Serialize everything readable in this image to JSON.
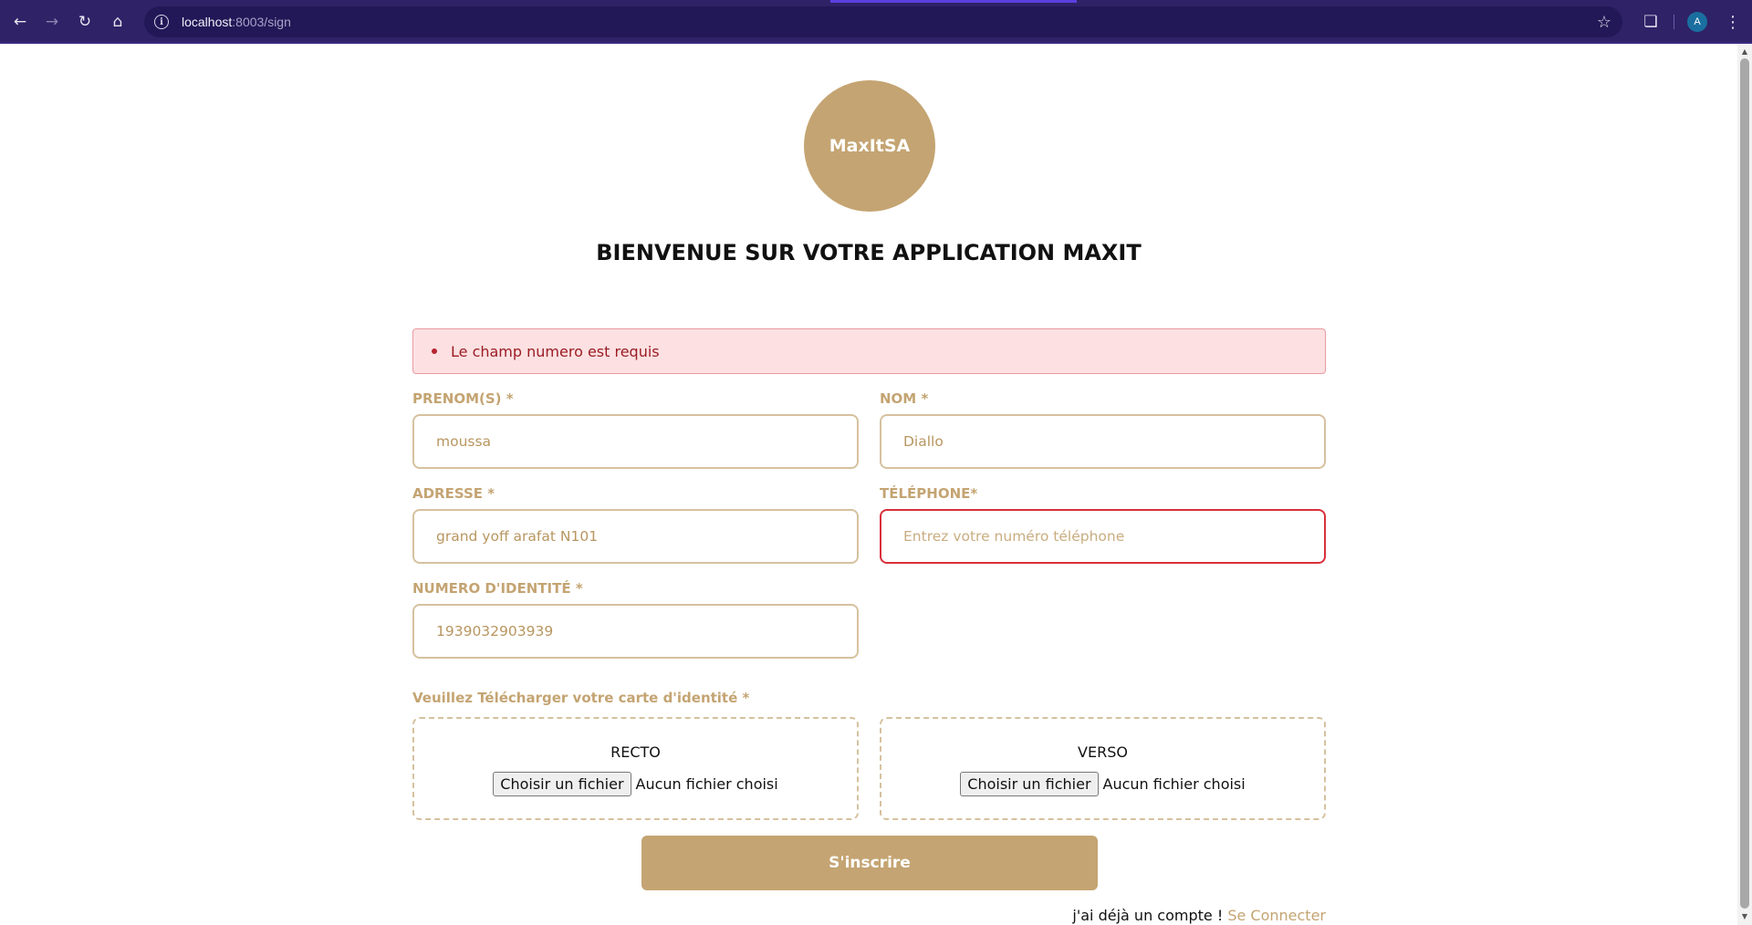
{
  "browser": {
    "url_host": "localhost",
    "url_rest": ":8003/sign",
    "avatar_letter": "A"
  },
  "logo": {
    "text": "MaxItSA"
  },
  "title": "BIENVENUE SUR VOTRE APPLICATION MAXIT",
  "alert": {
    "message": "Le champ numero est requis"
  },
  "form": {
    "prenom": {
      "label": "PRENOM(S) *",
      "value": "moussa"
    },
    "nom": {
      "label": "NOM *",
      "value": "Diallo"
    },
    "adresse": {
      "label": "ADRESSE *",
      "value": "grand yoff arafat N101"
    },
    "telephone": {
      "label": "TÉLÉPHONE*",
      "placeholder": "Entrez votre numéro téléphone"
    },
    "identite": {
      "label": "NUMERO D'IDENTITÉ *",
      "value": "1939032903939"
    }
  },
  "upload": {
    "label": "Veuillez Télécharger votre carte d'identité *",
    "recto": {
      "title": "RECTO",
      "button": "Choisir un fichier",
      "status": "Aucun fichier choisi"
    },
    "verso": {
      "title": "VERSO",
      "button": "Choisir un fichier",
      "status": "Aucun fichier choisi"
    }
  },
  "submit_label": "S'inscrire",
  "login": {
    "prompt": "j'ai déjà un compte ! ",
    "link": "Se Connecter"
  },
  "colors": {
    "accent": "#c4a472",
    "error": "#d8303a",
    "chrome": "#2f2266"
  }
}
